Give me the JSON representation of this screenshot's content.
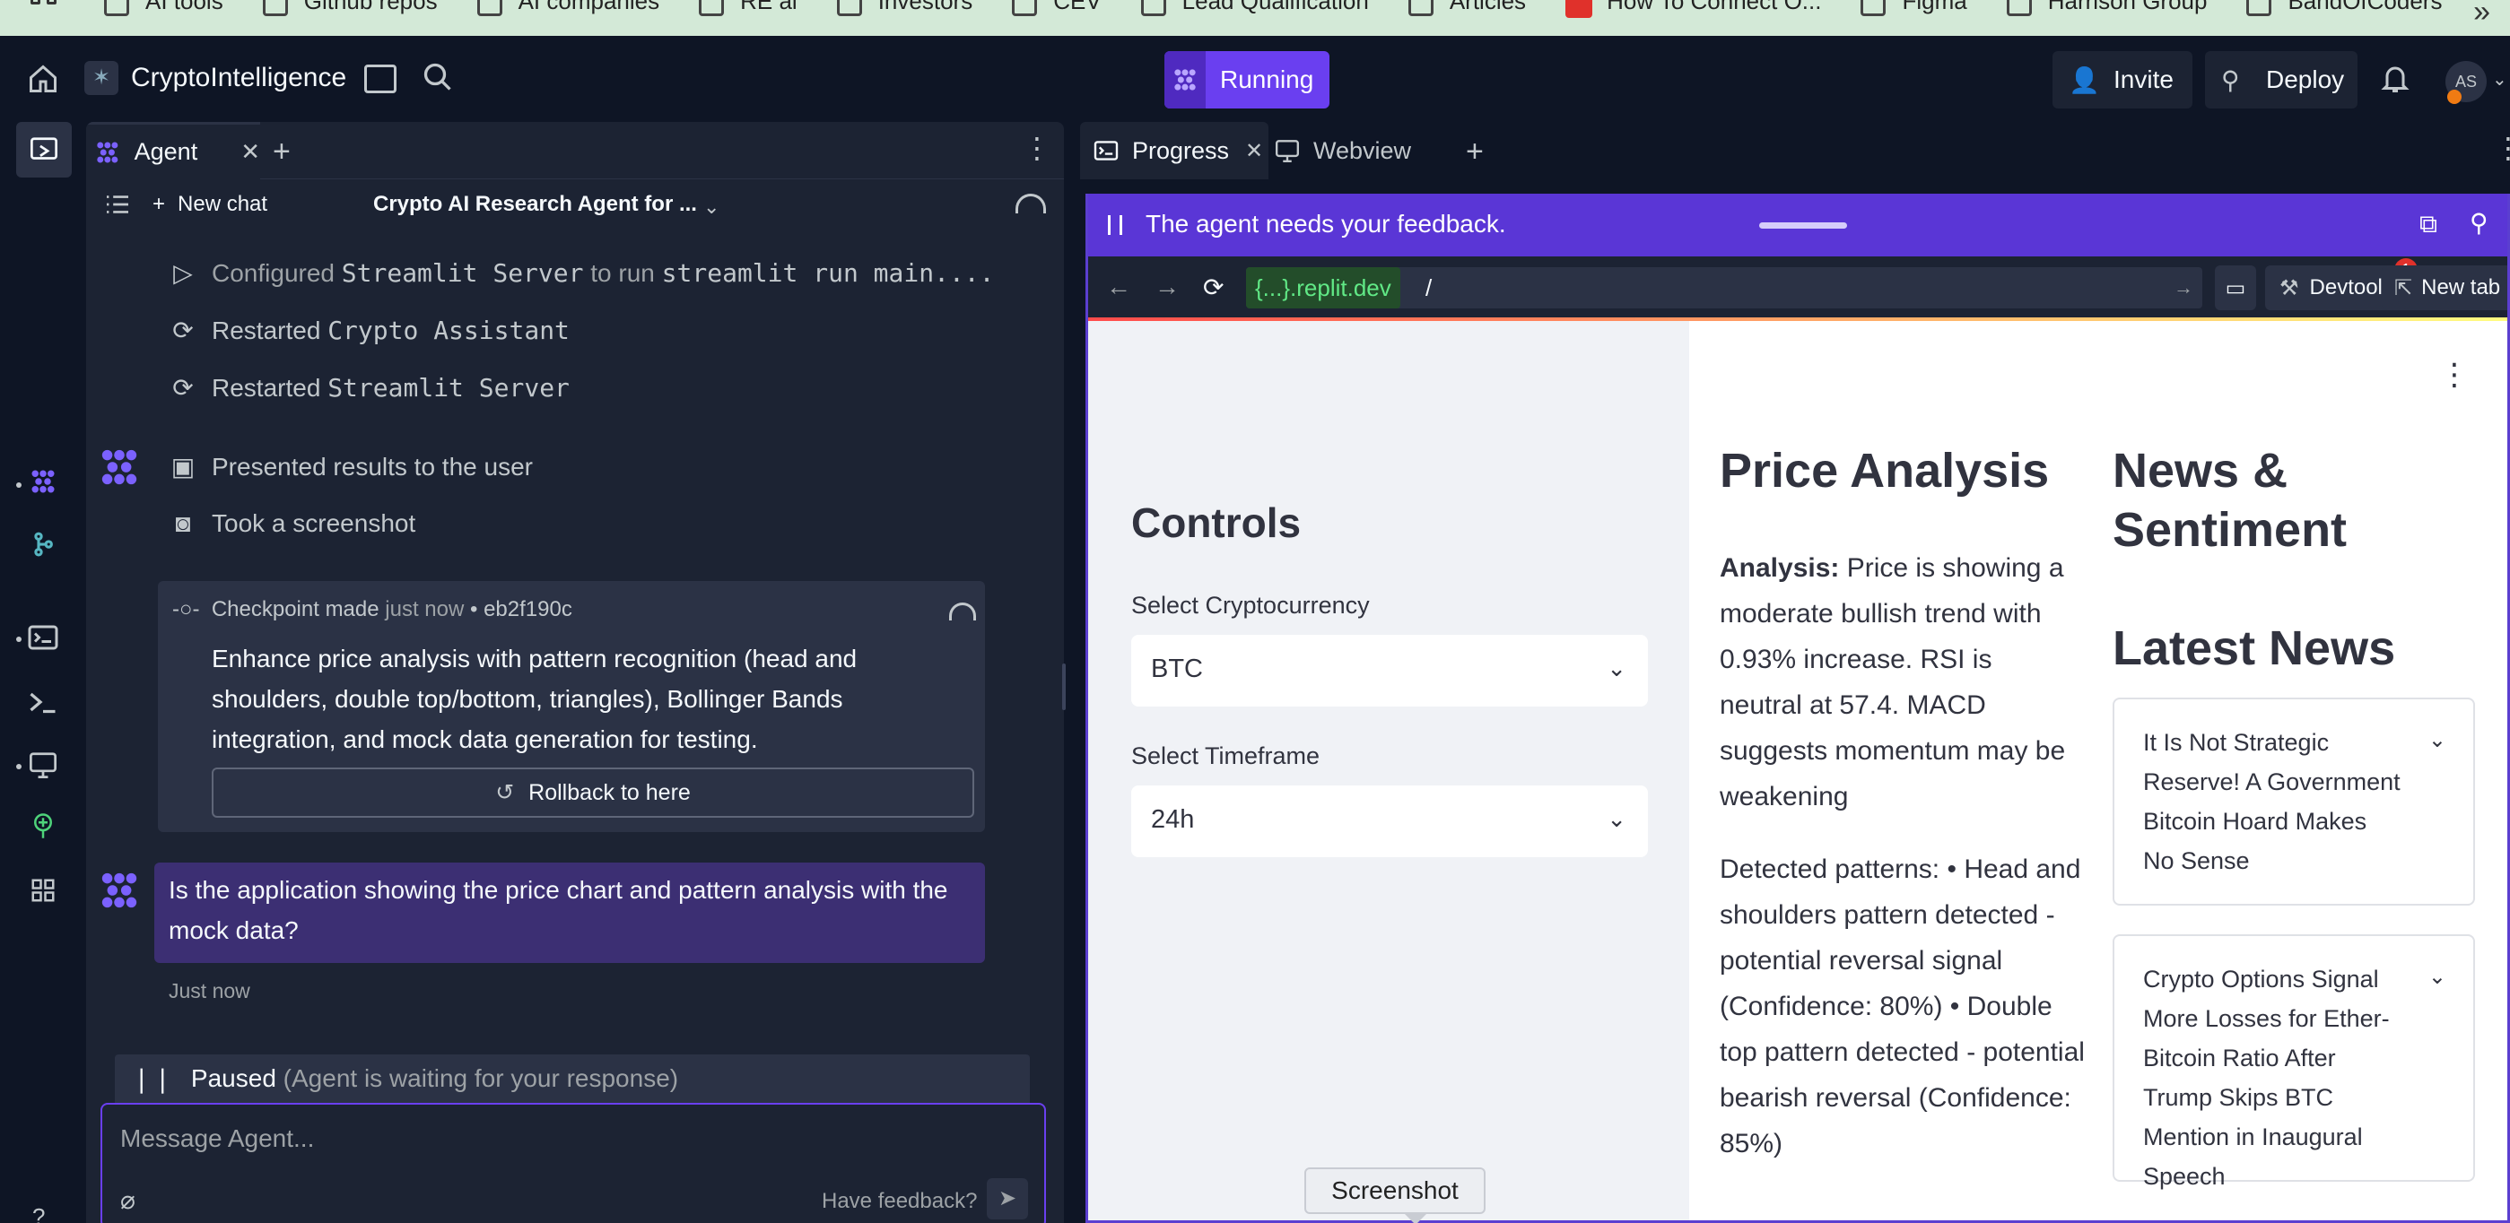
{
  "bookmarks": [
    {
      "label": "AI tools"
    },
    {
      "label": "Github repos"
    },
    {
      "label": "AI companies"
    },
    {
      "label": "RE ai"
    },
    {
      "label": "Investors"
    },
    {
      "label": "CEV"
    },
    {
      "label": "Lead Qualification"
    },
    {
      "label": "Articles"
    },
    {
      "label": "How To Connect O..."
    },
    {
      "label": "Figma"
    },
    {
      "label": "Harrison Group"
    },
    {
      "label": "BandOfCoders"
    }
  ],
  "header": {
    "app_name": "CryptoIntelligence",
    "run_label": "Running",
    "invite_label": "Invite",
    "deploy_label": "Deploy",
    "avatar_initials": "AS"
  },
  "agent_panel": {
    "tab_label": "Agent",
    "new_chat_label": "New chat",
    "chat_title": "Crypto AI Research Agent for ...",
    "log": [
      {
        "icon": "play-icon",
        "prefix": "Configured",
        "code": "Streamlit Server",
        "mid": "to run",
        "code2": "streamlit run main...."
      },
      {
        "icon": "refresh-icon",
        "prefix": "Restarted",
        "code": "Crypto Assistant"
      },
      {
        "icon": "refresh-icon",
        "prefix": "Restarted",
        "code": "Streamlit Server"
      }
    ],
    "presented": "Presented results to the user",
    "screenshot": "Took a screenshot",
    "checkpoint": {
      "label": "Checkpoint made",
      "time": "just now",
      "sep": "•",
      "hash": "eb2f190c",
      "description": "Enhance price analysis with pattern recognition (head and shoulders, double top/bottom, triangles), Bollinger Bands integration, and mock data generation for testing.",
      "rollback_label": "Rollback to here"
    },
    "user_message": "Is the application showing the price chart and pattern analysis with the mock data?",
    "user_message_time": "Just now",
    "paused_label": "Paused",
    "paused_detail": "(Agent is waiting for your response)",
    "input_placeholder": "Message Agent...",
    "feedback_label": "Have feedback?"
  },
  "right_panel": {
    "tabs": [
      {
        "label": "Progress"
      },
      {
        "label": "Webview"
      }
    ],
    "feedback_banner": "The agent needs your feedback.",
    "url_domain": "{...}.replit.dev",
    "url_path": "/",
    "devtools_label": "Devtools",
    "devtools_badge": "1",
    "newtab_label": "New tab"
  },
  "app": {
    "sidebar": {
      "title": "Controls",
      "crypto_label": "Select Cryptocurrency",
      "crypto_value": "BTC",
      "timeframe_label": "Select Timeframe",
      "timeframe_value": "24h"
    },
    "price": {
      "title": "Price Analysis",
      "analysis_label": "Analysis:",
      "analysis_text": "Price is showing a moderate bullish trend with 0.93% increase. RSI is neutral at 57.4. MACD suggests momentum may be weakening",
      "patterns_text": "Detected patterns: • Head and shoulders pattern detected - potential reversal signal (Confidence: 80%) • Double top pattern detected - potential bearish reversal (Confidence: 85%)"
    },
    "news": {
      "title": "News & Sentiment",
      "latest_title": "Latest News",
      "items": [
        {
          "headline": "It Is Not Strategic Reserve! A Government Bitcoin Hoard Makes No Sense"
        },
        {
          "headline": "Crypto Options Signal More Losses for Ether-Bitcoin Ratio After Trump Skips BTC Mention in Inaugural Speech"
        }
      ]
    }
  },
  "tooltip": {
    "label": "Screenshot"
  },
  "colors": {
    "accent": "#6a3ff0",
    "panel_bg": "#1c2333",
    "app_bg": "#0e1525",
    "user_msg_bg": "#3c2f73",
    "feedback_bar": "#5a36d6"
  }
}
